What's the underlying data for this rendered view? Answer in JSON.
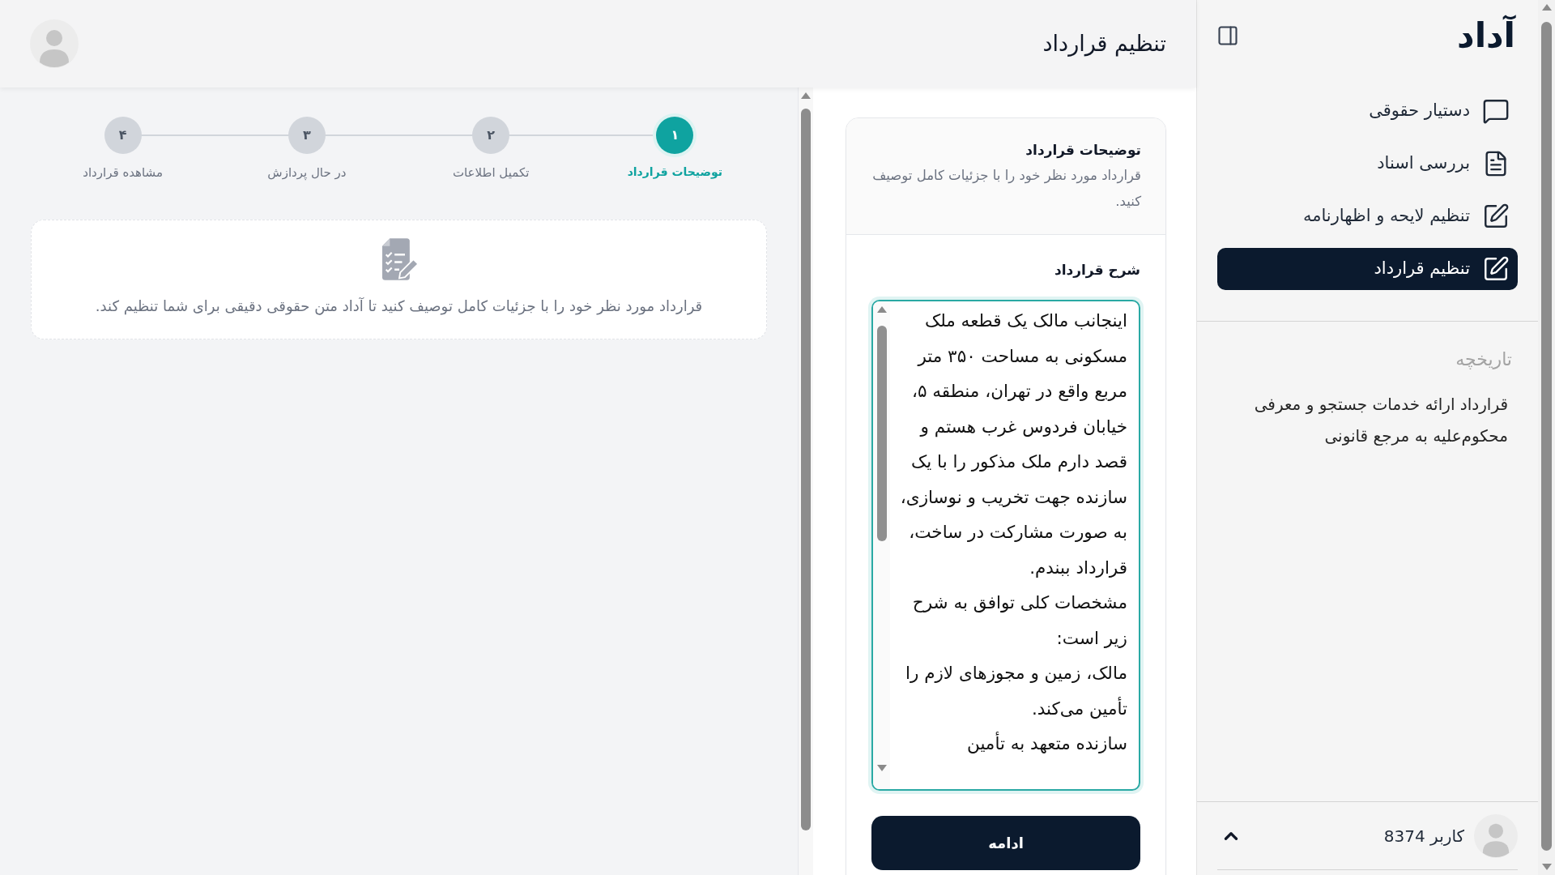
{
  "sidebar": {
    "logo": "آداد",
    "nav_items": [
      {
        "label": "دستیار حقوقی",
        "kind": "chat",
        "selected": false
      },
      {
        "label": "بررسی اسناد",
        "kind": "document",
        "selected": false
      },
      {
        "label": "تنظیم لایحه و اظهارنامه",
        "kind": "edit",
        "selected": false
      },
      {
        "label": "تنظیم قرارداد",
        "kind": "edit",
        "selected": true
      }
    ],
    "history_title": "تاریخچه",
    "history_items": [
      "قرارداد ارائه خدمات جستجو و معرفی محکوم‌علیه به مرجع قانونی"
    ],
    "user_name": "کاربر 8374"
  },
  "header": {
    "title": "تنظیم قرارداد"
  },
  "stepper": [
    {
      "number": "۱",
      "label": "توضیحات قرارداد",
      "selected": true
    },
    {
      "number": "۲",
      "label": "تکمیل اطلاعات",
      "selected": false
    },
    {
      "number": "۳",
      "label": "در حال پردازش",
      "selected": false
    },
    {
      "number": "۴",
      "label": "مشاهده قرارداد",
      "selected": false
    }
  ],
  "info_card": {
    "text": "قرارداد مورد نظر خود را با جزئیات کامل توصیف کنید تا آداد متن حقوقی دقیقی برای شما تنظیم کند."
  },
  "form": {
    "title": "توضیحات قرارداد",
    "description": "قرارداد مورد نظر خود را با جزئیات کامل توصیف کنید.",
    "field_label": "شرح قرارداد",
    "value": "اینجانب مالک یک قطعه ملک مسکونی به مساحت ۳۵۰ متر مربع واقع در تهران، منطقه ۵، خیابان فردوس غرب هستم و قصد دارم ملک مذکور را با یک سازنده جهت تخریب و نوسازی، به صورت مشارکت در ساخت، قرارداد ببندم.\nمشخصات کلی توافق به شرح زیر است:\nمالک، زمین و مجوزهای لازم را تأمین می‌کند.\nسازنده متعهد به تأمین",
    "button": "ادامه"
  }
}
